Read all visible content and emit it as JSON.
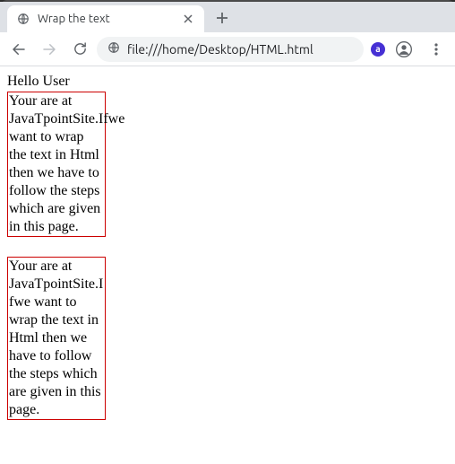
{
  "window": {
    "title": "Wrap the text"
  },
  "tab": {
    "title": "Wrap the text"
  },
  "omnibox": {
    "url": "file:///home/Desktop/HTML.html"
  },
  "page": {
    "greeting": "Hello User",
    "box1_text": "Your are at JavaTpointSite.Ifwe want to wrap the text in Html then we have to follow the steps which are given in this page.",
    "box2_text": "Your are at JavaTpointSite.Ifwe want to wrap the text in Html then we have to follow the steps which are given in this page."
  },
  "icons": {
    "extension_letter": "a"
  }
}
